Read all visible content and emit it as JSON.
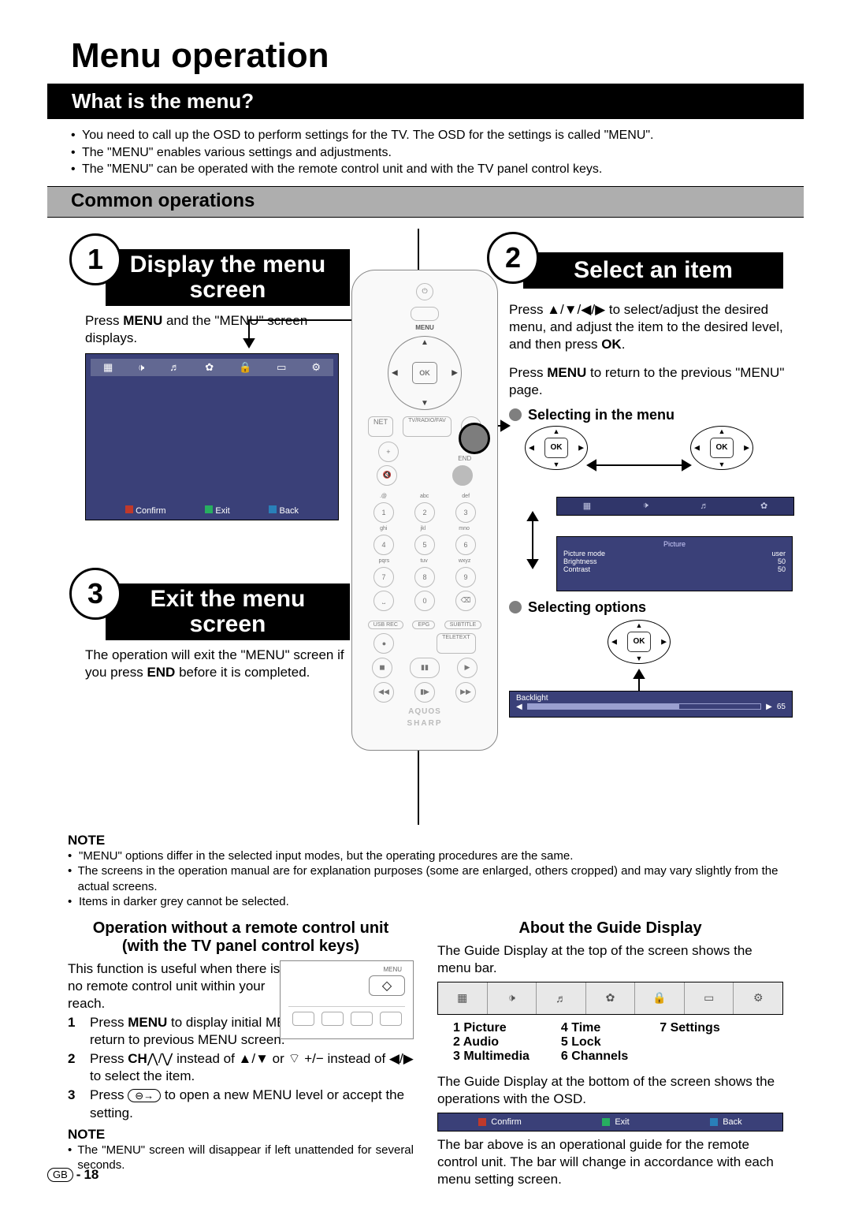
{
  "page": {
    "title": "Menu operation",
    "section1_title": "What is the menu?",
    "bullets": [
      "You need to call up the OSD to perform settings for the TV. The OSD for the settings is called \"MENU\".",
      "The \"MENU\" enables various settings and adjustments.",
      "The \"MENU\" can be operated with the remote control unit and with the TV panel control keys."
    ],
    "section2_title": "Common operations"
  },
  "panel1": {
    "num": "1",
    "title_a": "Display the menu",
    "title_b": "screen",
    "body_pre": "Press ",
    "body_b1": "MENU",
    "body_mid": " and the \"MENU\" screen displays.",
    "osd_footer": {
      "a": "Confirm",
      "b": "Exit",
      "c": "Back"
    }
  },
  "panel3": {
    "num": "3",
    "title_a": "Exit the menu",
    "title_b": "screen",
    "body_pre": "The operation will exit the \"MENU\" screen if you press ",
    "body_b1": "END",
    "body_post": " before it is completed."
  },
  "panel2": {
    "num": "2",
    "title": "Select an item",
    "p1_a": "Press ▲/▼/◀/▶ to select/adjust the desired menu, and adjust the item to the desired level, and then press ",
    "p1_b": "OK",
    "p1_c": ".",
    "p2_a": "Press ",
    "p2_b": "MENU",
    "p2_c": " to return to the previous \"MENU\" page.",
    "sub1": "Selecting in the menu",
    "sub2": "Selecting options",
    "mini_menu": {
      "header": "Picture",
      "rows": [
        {
          "k": "Picture mode",
          "v": "user"
        },
        {
          "k": "Brightness",
          "v": "50"
        },
        {
          "k": "Contrast",
          "v": "50"
        }
      ],
      "backlight": {
        "k": "Backlight",
        "v": "65"
      }
    }
  },
  "note1": {
    "header": "NOTE",
    "items": [
      "\"MENU\" options differ in the selected input modes, but the operating procedures are the same.",
      "The screens in the operation manual are for explanation purposes (some are enlarged, others cropped) and may vary slightly from the actual screens.",
      "Items in darker grey cannot be selected."
    ]
  },
  "leftcol": {
    "h_a": "Operation without a remote control unit",
    "h_b": "(with the TV panel control keys)",
    "intro": "This function is useful when there is no remote control unit within your reach.",
    "steps": [
      {
        "n": "1",
        "pre": "Press ",
        "b": "MENU",
        "post": " to display initial MENU screen, or to return to previous MENU screen."
      },
      {
        "n": "2",
        "pre": "Press ",
        "b": "CH",
        "post1": "⋀/⋁ instead of ▲/▼ or ",
        "post2": "+/− instead of ◀/▶ to select the item.",
        "vol": "⌔"
      },
      {
        "n": "3",
        "pre": "Press ",
        "inp": "⊖→",
        "post": " to open a new MENU level or accept the setting."
      }
    ],
    "note_h": "NOTE",
    "note_b": "The \"MENU\" screen will disappear if left unattended for several seconds."
  },
  "rightcol": {
    "h": "About the Guide Display",
    "p1": "The Guide Display at the top of the screen shows the menu bar.",
    "legend": [
      [
        "1 Picture",
        "2 Audio",
        "3 Multimedia"
      ],
      [
        "4 Time",
        "5 Lock",
        "6 Channels"
      ],
      [
        "7 Settings"
      ]
    ],
    "p2": "The Guide Display at the bottom of the screen shows the operations with the OSD.",
    "ops": {
      "a": "Confirm",
      "b": "Exit",
      "c": "Back"
    },
    "p3": "The bar above is an operational guide for the remote control unit. The bar will change in accordance with each menu setting screen."
  },
  "footer": {
    "gb": "GB",
    "dash": " - ",
    "page": "18"
  },
  "remote": {
    "menu": "MENU",
    "ok": "OK",
    "end": "END",
    "net": "NET",
    "tvr": "TV/RADIO/FAV",
    "brand1": "AQUOS",
    "brand2": "SHARP"
  }
}
